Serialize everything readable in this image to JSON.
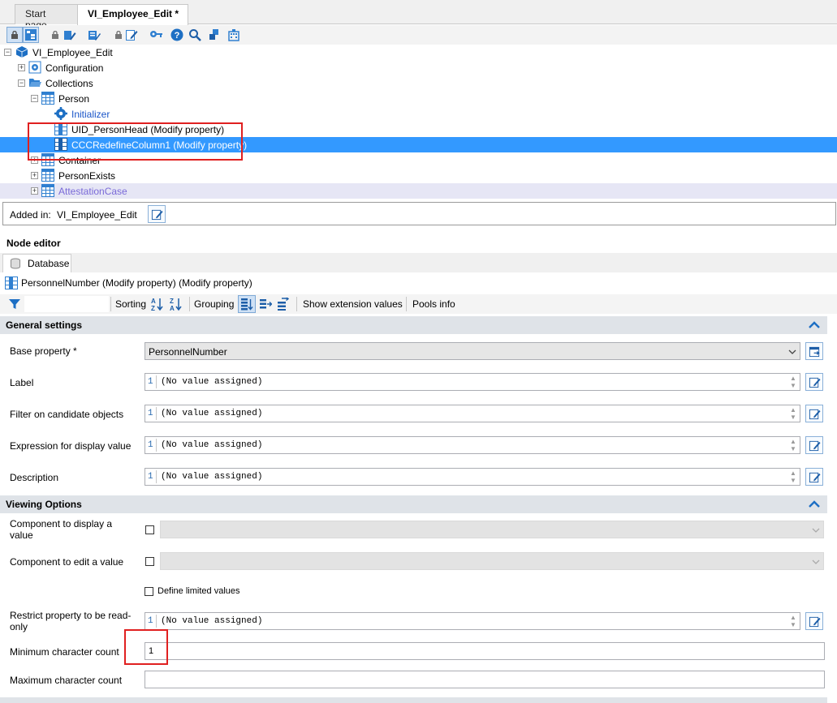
{
  "tabs": [
    {
      "label": "Start page"
    },
    {
      "label": "VI_Employee_Edit *"
    }
  ],
  "tree": {
    "root": "VI_Employee_Edit",
    "configuration": "Configuration",
    "collections": "Collections",
    "person": "Person",
    "initializer": "Initializer",
    "uid_personhead": "UID_PersonHead (Modify property)",
    "ccc_redefine": "CCCRedefineColumn1 (Modify property)",
    "container": "Container",
    "personexists": "PersonExists",
    "attestationcase": "AttestationCase"
  },
  "added_in": {
    "label": "Added in:",
    "value": "VI_Employee_Edit"
  },
  "node_editor": {
    "title": "Node editor",
    "database_tab": "Database",
    "node_title": "PersonnelNumber (Modify property) (Modify property)"
  },
  "filter_bar": {
    "sorting": "Sorting",
    "grouping": "Grouping",
    "show_extension_values": "Show extension values",
    "pools_info": "Pools info"
  },
  "general_settings": {
    "title": "General settings",
    "base_property_label": "Base property *",
    "base_property_value": "PersonnelNumber",
    "label_label": "Label",
    "filter_label": "Filter on candidate objects",
    "expression_label": "Expression for display value",
    "description_label": "Description",
    "line_number": "1",
    "no_value": "(No value assigned)"
  },
  "viewing_options": {
    "title": "Viewing Options",
    "component_display_label": "Component to display a value",
    "component_edit_label": "Component to edit a value",
    "define_limited_values": "Define limited values",
    "restrict_readonly_label": "Restrict property to be read-only",
    "min_char_label": "Minimum character count",
    "min_char_value": "1",
    "max_char_label": "Maximum character count",
    "max_char_value": ""
  },
  "colors": {
    "selection": "#3399ff",
    "highlight_row": "#e6e6f5",
    "section_header": "#dfe3e8",
    "annotation_red": "#e02020",
    "link_blue": "#1a55c8",
    "attestation_purple": "#7a6ad8"
  }
}
